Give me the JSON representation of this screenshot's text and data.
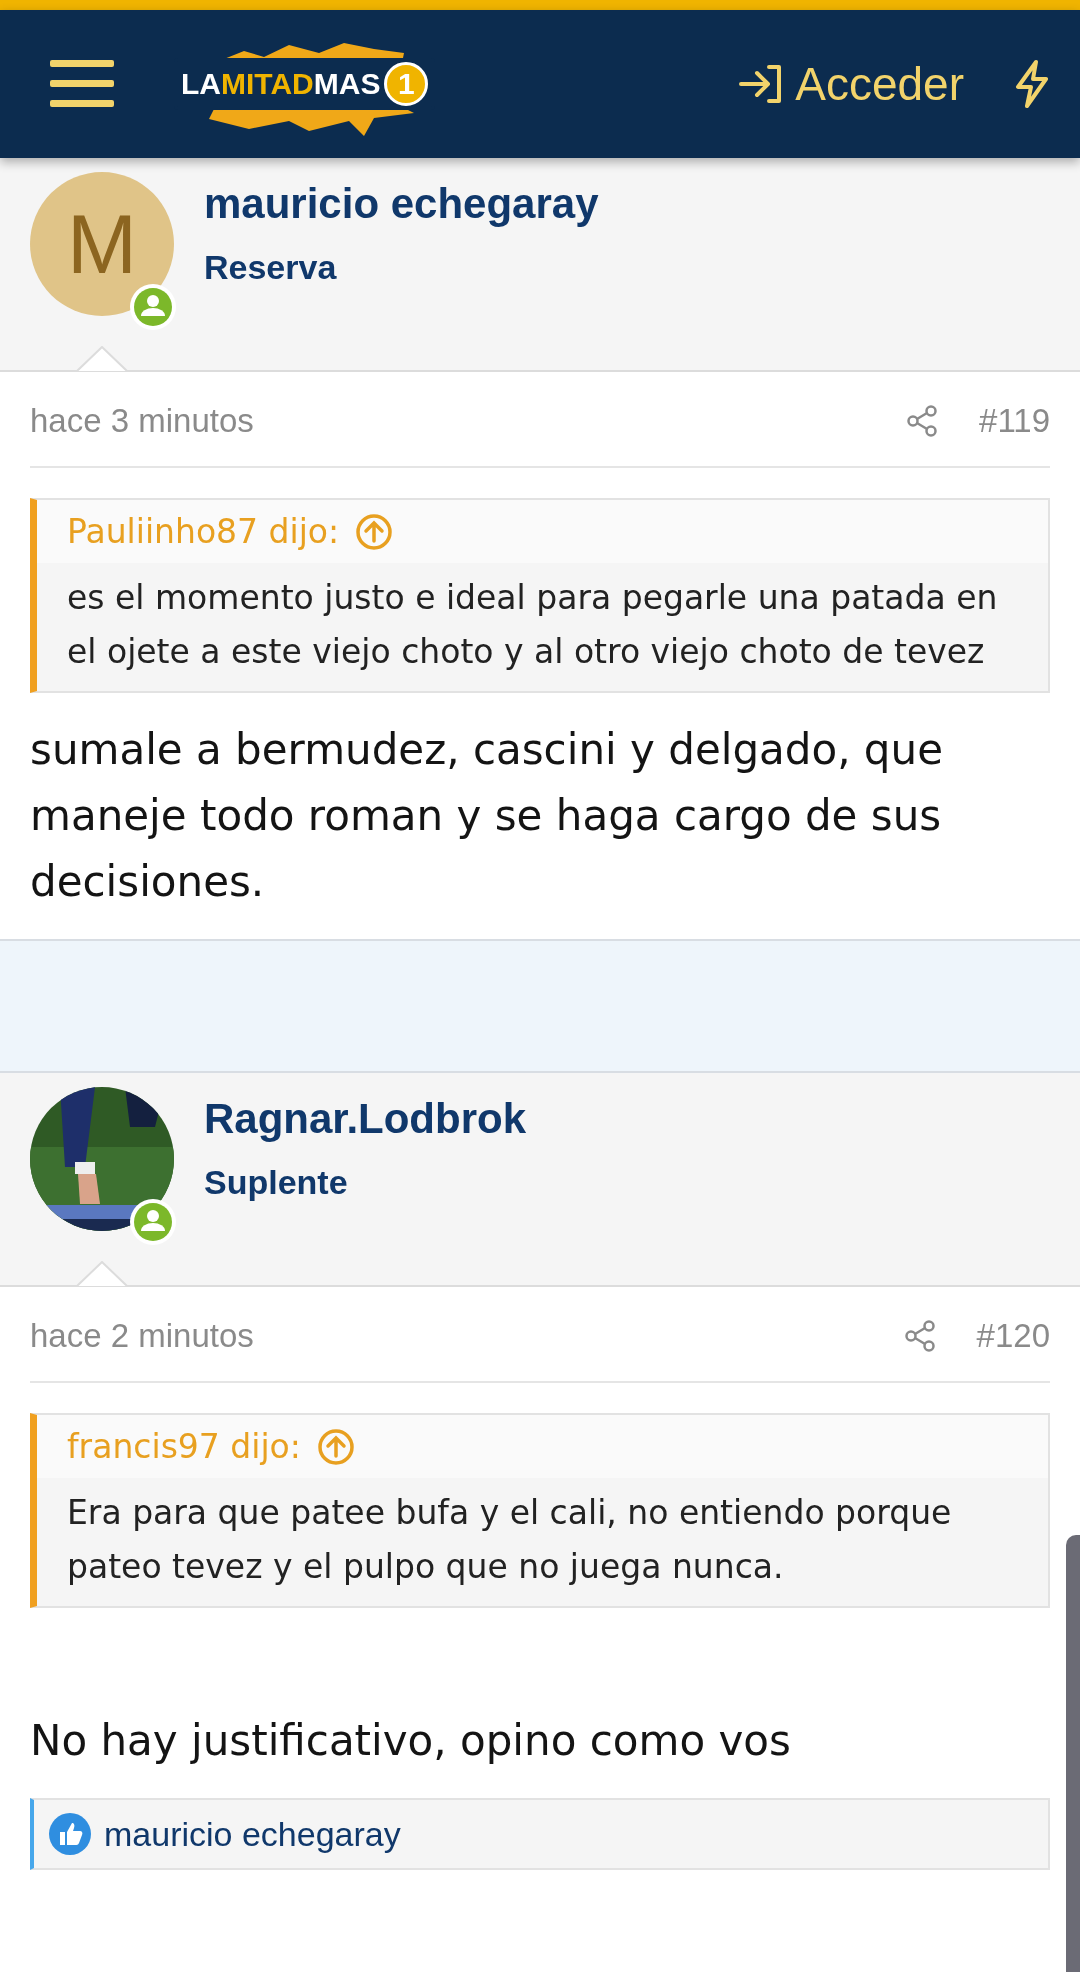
{
  "header": {
    "logo": {
      "parts": [
        "LA",
        "MITAD",
        "MAS",
        "1"
      ]
    },
    "login": "Acceder"
  },
  "posts": [
    {
      "user": {
        "name": "mauricio echegaray",
        "role": "Reserva",
        "avatar": {
          "kind": "letter",
          "letter": "M"
        },
        "online": true
      },
      "time": "hace 3 minutos",
      "number": "#119",
      "quote": {
        "author": "Pauliinho87 dijo:",
        "text": "es el momento justo e ideal para pegarle una patada en el ojete a este viejo choto y al otro viejo choto de tevez"
      },
      "text": "sumale a bermudez, cascini y delgado, que maneje todo roman y se haga cargo de sus decisiones."
    },
    {
      "user": {
        "name": "Ragnar.Lodbrok",
        "role": "Suplente",
        "online": true
      },
      "time": "hace 2 minutos",
      "number": "#120",
      "quote": {
        "author": "francis97 dijo:",
        "text": "Era para que patee bufa y el cali, no entiendo porque pateo tevez y el pulpo que no juega nunca."
      },
      "text": "No hay justificativo, opino como vos",
      "reactions": "mauricio echegaray"
    }
  ]
}
